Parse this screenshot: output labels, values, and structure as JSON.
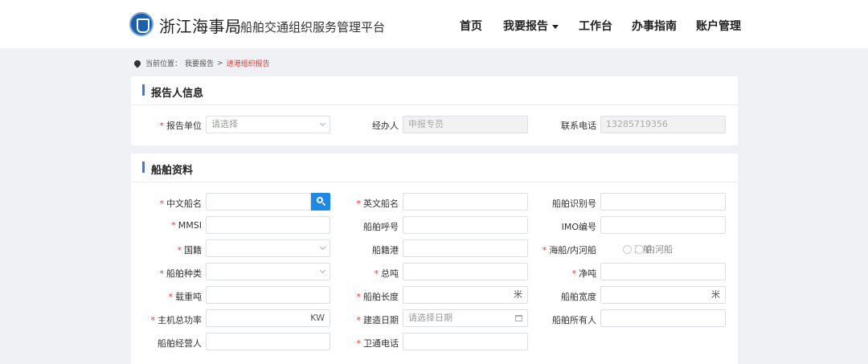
{
  "header": {
    "brand": "浙江海事局",
    "subtitle": "船舶交通组织服务管理平台",
    "nav": [
      {
        "label": "首页",
        "has_dropdown": false
      },
      {
        "label": "我要报告",
        "has_dropdown": true
      },
      {
        "label": "工作台",
        "has_dropdown": false
      },
      {
        "label": "办事指南",
        "has_dropdown": false
      },
      {
        "label": "账户管理",
        "has_dropdown": false
      }
    ]
  },
  "breadcrumb": {
    "prefix": "当前位置：",
    "parent": "我要报告",
    "separator": ">",
    "current": "进港组织报告"
  },
  "reporter_section": {
    "title": "报告人信息",
    "fields": {
      "unit": {
        "label": "报告单位",
        "required": true,
        "value": "",
        "placeholder": "请选择",
        "type": "select"
      },
      "handler": {
        "label": "经办人",
        "required": false,
        "value": "申报专员",
        "disabled": true
      },
      "phone": {
        "label": "联系电话",
        "required": false,
        "value": "13285719356",
        "disabled": true
      }
    }
  },
  "ship_section": {
    "title": "船舶资料",
    "fields": {
      "cn_name": {
        "label": "中文船名",
        "required": true,
        "value": ""
      },
      "en_name": {
        "label": "英文船名",
        "required": true,
        "value": ""
      },
      "ship_id": {
        "label": "船舶识别号",
        "required": false,
        "value": ""
      },
      "mmsi": {
        "label": "MMSI",
        "required": true,
        "value": ""
      },
      "call_sign": {
        "label": "船舶呼号",
        "required": false,
        "value": ""
      },
      "imo": {
        "label": "IMO编号",
        "required": false,
        "value": ""
      },
      "nationality": {
        "label": "国籍",
        "required": true,
        "value": "",
        "type": "select"
      },
      "port_of_registry": {
        "label": "船籍港",
        "required": false,
        "value": ""
      },
      "sea_or_river": {
        "label": "海船/内河船",
        "required": true,
        "options": [
          "海船",
          "内河船"
        ],
        "selected": null
      },
      "ship_type": {
        "label": "船舶种类",
        "required": true,
        "value": "",
        "type": "select"
      },
      "gross_tonnage": {
        "label": "总吨",
        "required": true,
        "value": ""
      },
      "net_tonnage": {
        "label": "净吨",
        "required": true,
        "value": ""
      },
      "deadweight": {
        "label": "载重吨",
        "required": true,
        "value": ""
      },
      "length": {
        "label": "船舶长度",
        "required": true,
        "value": "",
        "unit": "米"
      },
      "width": {
        "label": "船舶宽度",
        "required": false,
        "value": "",
        "unit": "米"
      },
      "main_power": {
        "label": "主机总功率",
        "required": true,
        "value": "",
        "unit": "KW"
      },
      "build_date": {
        "label": "建造日期",
        "required": true,
        "value": "",
        "placeholder": "请选择日期"
      },
      "owner": {
        "label": "船舶所有人",
        "required": false,
        "value": ""
      },
      "operator": {
        "label": "船舶经营人",
        "required": false,
        "value": ""
      },
      "sat_phone": {
        "label": "卫通电话",
        "required": true,
        "value": ""
      }
    }
  }
}
